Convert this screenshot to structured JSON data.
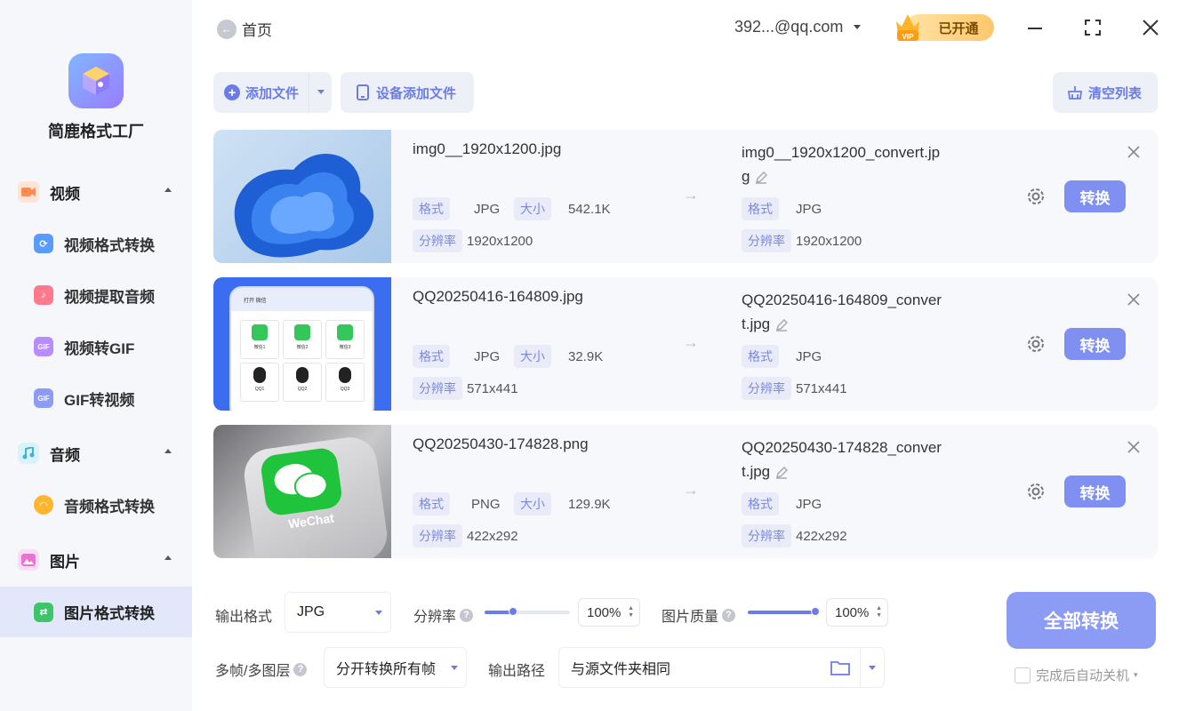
{
  "app": {
    "name": "简鹿格式工厂"
  },
  "sidebar": {
    "sections": [
      {
        "label": "视频",
        "color": "#ff9b6a"
      },
      {
        "label": "音频",
        "color": "#5fc8e8"
      },
      {
        "label": "图片",
        "color": "#f08adf"
      }
    ],
    "items": [
      {
        "label": "视频格式转换",
        "icon": "video-convert-icon"
      },
      {
        "label": "视频提取音频",
        "icon": "music-note-icon"
      },
      {
        "label": "视频转GIF",
        "icon": "gif-icon"
      },
      {
        "label": "GIF转视频",
        "icon": "gif-video-icon"
      },
      {
        "label": "音频格式转换",
        "icon": "headphones-icon"
      },
      {
        "label": "图片格式转换",
        "icon": "image-convert-icon"
      }
    ]
  },
  "topbar": {
    "home_label": "首页",
    "account": "392...@qq.com",
    "vip_label": "已开通",
    "vip_badge": "VIP"
  },
  "toolbar": {
    "add_file": "添加文件",
    "device_add": "设备添加文件",
    "clear_list": "清空列表"
  },
  "files": [
    {
      "name": "img0__1920x1200.jpg",
      "output_name": "img0__1920x1200_convert.jpg",
      "format": "JPG",
      "size": "542.1K",
      "resolution": "1920x1200",
      "out_format": "JPG",
      "out_resolution": "1920x1200"
    },
    {
      "name": "QQ20250416-164809.jpg",
      "output_name": "QQ20250416-164809_convert.jpg",
      "format": "JPG",
      "size": "32.9K",
      "resolution": "571x441",
      "out_format": "JPG",
      "out_resolution": "571x441"
    },
    {
      "name": "QQ20250430-174828.png",
      "output_name": "QQ20250430-174828_convert.jpg",
      "format": "PNG",
      "size": "129.9K",
      "resolution": "422x292",
      "out_format": "JPG",
      "out_resolution": "422x292"
    }
  ],
  "labels": {
    "format": "格式",
    "size": "大小",
    "resolution": "分辨率",
    "convert": "转换"
  },
  "thumb2": {
    "title": "打开 微信",
    "cells": [
      "微信1",
      "微信2",
      "微信3",
      "QQ1",
      "QQ2",
      "QQ3"
    ]
  },
  "thumb3": {
    "brand": "WeChat"
  },
  "settings": {
    "output_format_label": "输出格式",
    "output_format": "JPG",
    "resolution_label": "分辨率",
    "resolution_value": "100%",
    "resolution_level": 0.33,
    "quality_label": "图片质量",
    "quality_value": "100%",
    "quality_level": 0.95,
    "multiframe_label": "多帧/多图层",
    "multiframe_value": "分开转换所有帧",
    "output_path_label": "输出路径",
    "output_path_value": "与源文件夹相同",
    "convert_all": "全部转换",
    "auto_shutdown": "完成后自动关机"
  }
}
